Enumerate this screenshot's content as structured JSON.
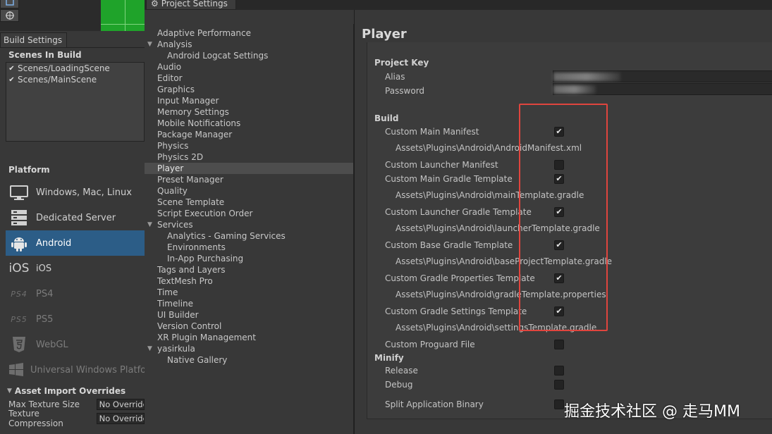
{
  "build_settings": {
    "tab_label": "Build Settings",
    "scenes_header": "Scenes In Build",
    "scenes": [
      {
        "name": "Scenes/LoadingScene",
        "checked": true
      },
      {
        "name": "Scenes/MainScene",
        "checked": true
      }
    ],
    "platform_header": "Platform",
    "platforms": [
      {
        "label": "Windows, Mac, Linux",
        "icon": "monitor-icon",
        "selected": false,
        "enabled": true
      },
      {
        "label": "Dedicated Server",
        "icon": "server-icon",
        "selected": false,
        "enabled": true
      },
      {
        "label": "Android",
        "icon": "android-icon",
        "selected": true,
        "enabled": true
      },
      {
        "label": "iOS",
        "icon": "ios-icon",
        "icon_text": "iOS",
        "selected": false,
        "enabled": true
      },
      {
        "label": "PS4",
        "icon": "ps4-icon",
        "icon_text": "PS4",
        "selected": false,
        "enabled": false
      },
      {
        "label": "PS5",
        "icon": "ps5-icon",
        "icon_text": "PS5",
        "selected": false,
        "enabled": false
      },
      {
        "label": "WebGL",
        "icon": "html5-icon",
        "selected": false,
        "enabled": false
      },
      {
        "label": "Universal Windows Platfo",
        "icon": "windows-icon",
        "selected": false,
        "enabled": false
      }
    ],
    "asset_import": {
      "header": "Asset Import Overrides",
      "rows": [
        {
          "label": "Max Texture Size",
          "value": "No Override"
        },
        {
          "label": "Texture Compression",
          "value": "No Override"
        }
      ]
    }
  },
  "project_settings": {
    "tab_label": "Project Settings",
    "nav": [
      {
        "label": "Adaptive Performance",
        "level": 0,
        "fold": false
      },
      {
        "label": "Analysis",
        "level": 0,
        "fold": true
      },
      {
        "label": "Android Logcat Settings",
        "level": 1,
        "fold": false
      },
      {
        "label": "Audio",
        "level": 0,
        "fold": false
      },
      {
        "label": "Editor",
        "level": 0,
        "fold": false
      },
      {
        "label": "Graphics",
        "level": 0,
        "fold": false
      },
      {
        "label": "Input Manager",
        "level": 0,
        "fold": false
      },
      {
        "label": "Memory Settings",
        "level": 0,
        "fold": false
      },
      {
        "label": "Mobile Notifications",
        "level": 0,
        "fold": false
      },
      {
        "label": "Package Manager",
        "level": 0,
        "fold": false
      },
      {
        "label": "Physics",
        "level": 0,
        "fold": false
      },
      {
        "label": "Physics 2D",
        "level": 0,
        "fold": false
      },
      {
        "label": "Player",
        "level": 0,
        "fold": false,
        "selected": true
      },
      {
        "label": "Preset Manager",
        "level": 0,
        "fold": false
      },
      {
        "label": "Quality",
        "level": 0,
        "fold": false
      },
      {
        "label": "Scene Template",
        "level": 0,
        "fold": false
      },
      {
        "label": "Script Execution Order",
        "level": 0,
        "fold": false
      },
      {
        "label": "Services",
        "level": 0,
        "fold": true
      },
      {
        "label": "Analytics - Gaming Services",
        "level": 1,
        "fold": false
      },
      {
        "label": "Environments",
        "level": 1,
        "fold": false
      },
      {
        "label": "In-App Purchasing",
        "level": 1,
        "fold": false
      },
      {
        "label": "Tags and Layers",
        "level": 0,
        "fold": false
      },
      {
        "label": "TextMesh Pro",
        "level": 0,
        "fold": false
      },
      {
        "label": "Time",
        "level": 0,
        "fold": false
      },
      {
        "label": "Timeline",
        "level": 0,
        "fold": false
      },
      {
        "label": "UI Builder",
        "level": 0,
        "fold": false
      },
      {
        "label": "Version Control",
        "level": 0,
        "fold": false
      },
      {
        "label": "XR Plugin Management",
        "level": 0,
        "fold": false
      },
      {
        "label": "yasirkula",
        "level": 0,
        "fold": true
      },
      {
        "label": "Native Gallery",
        "level": 1,
        "fold": false
      }
    ]
  },
  "player": {
    "title": "Player",
    "project_key": {
      "header": "Project Key",
      "alias_label": "Alias",
      "password_label": "Password"
    },
    "build_header": "Build",
    "build_rows": [
      {
        "label": "Custom Main Manifest",
        "checked": true,
        "path": "Assets\\Plugins\\Android\\AndroidManifest.xml"
      },
      {
        "label": "Custom Launcher Manifest",
        "checked": false,
        "path": ""
      },
      {
        "label": "Custom Main Gradle Template",
        "checked": true,
        "path": "Assets\\Plugins\\Android\\mainTemplate.gradle"
      },
      {
        "label": "Custom Launcher Gradle Template",
        "checked": true,
        "path": "Assets\\Plugins\\Android\\launcherTemplate.gradle"
      },
      {
        "label": "Custom Base Gradle Template",
        "checked": true,
        "path": "Assets\\Plugins\\Android\\baseProjectTemplate.gradle"
      },
      {
        "label": "Custom Gradle Properties Template",
        "checked": true,
        "path": "Assets\\Plugins\\Android\\gradleTemplate.properties"
      },
      {
        "label": "Custom Gradle Settings Template",
        "checked": true,
        "path": "Assets\\Plugins\\Android\\settingsTemplate.gradle"
      },
      {
        "label": "Custom Proguard File",
        "checked": false,
        "path": ""
      }
    ],
    "minify_header": "Minify",
    "minify_rows": [
      {
        "label": "Release",
        "checked": false
      },
      {
        "label": "Debug",
        "checked": false
      }
    ],
    "split_binary": {
      "label": "Split Application Binary",
      "checked": false
    }
  },
  "watermark": "掘金技术社区 @ 走马MM",
  "colors": {
    "highlight": "#e0453e",
    "selected_platform": "#2c5d87"
  }
}
